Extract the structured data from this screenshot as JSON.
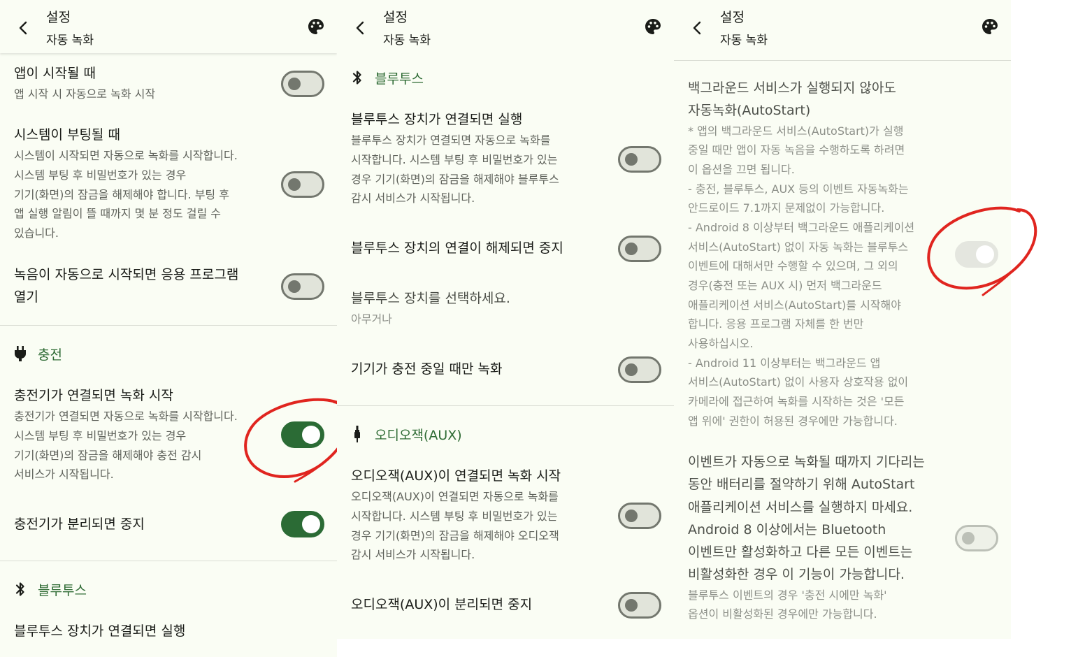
{
  "panels": [
    {
      "header": {
        "title": "설정",
        "subtitle": "자동 녹화"
      },
      "settings": [
        {
          "title": "앱이 시작될 때",
          "summary": "앱 시작 시 자동으로 녹화 시작",
          "toggle": "off"
        },
        {
          "title": "시스템이 부팅될 때",
          "summary_lines": [
            "시스템이 시작되면 자동으로 녹화를 시작합니다.",
            "시스템 부팅 후 비밀번호가 있는 경우",
            "기기(화면)의 잠금을 해제해야 합니다. 부팅 후",
            "앱 실행 알림이 뜰 때까지 몇 분 정도 걸릴 수",
            "있습니다."
          ],
          "toggle": "off"
        },
        {
          "title_lines": [
            "녹음이 자동으로 시작되면 응용 프로그램",
            "열기"
          ],
          "toggle": "off"
        },
        {
          "title": "충전기가 연결되면 녹화 시작",
          "summary_lines": [
            "충전기가 연결되면 자동으로 녹화를 시작합니다.",
            "시스템 부팅 후 비밀번호가 있는 경우",
            "기기(화면)의 잠금을 해제해야 충전 감시",
            "서비스가 시작됩니다."
          ],
          "toggle": "on"
        },
        {
          "title": "충전기가 분리되면 중지",
          "toggle": "on"
        },
        {
          "title": "블루투스 장치가 연결되면 실행"
        }
      ],
      "sections": [
        {
          "label": "충전",
          "icon": "plug-icon"
        },
        {
          "label": "블루투스",
          "icon": "bluetooth-icon"
        }
      ]
    },
    {
      "header": {
        "title": "설정",
        "subtitle": "자동 녹화"
      },
      "sections": [
        {
          "label": "블루투스",
          "icon": "bluetooth-icon"
        },
        {
          "label": "오디오잭(AUX)",
          "icon": "audio-jack-icon"
        }
      ],
      "settings": [
        {
          "title": "블루투스 장치가 연결되면 실행",
          "summary_lines": [
            "블루투스 장치가 연결되면 자동으로 녹화를",
            "시작합니다. 시스템 부팅 후 비밀번호가 있는",
            "경우 기기(화면)의 잠금을 해제해야 블루투스",
            "감시 서비스가 시작됩니다."
          ],
          "toggle": "off"
        },
        {
          "title": "블루투스 장치의 연결이 해제되면 중지",
          "toggle": "off"
        },
        {
          "title": "블루투스 장치를 선택하세요.",
          "summary": "아무거나"
        },
        {
          "title": "기기가 충전 중일 때만 녹화",
          "toggle": "off"
        },
        {
          "title": "오디오잭(AUX)이 연결되면 녹화 시작",
          "summary_lines": [
            "오디오잭(AUX)이 연결되면 자동으로 녹화를",
            "시작합니다. 시스템 부팅 후 비밀번호가 있는",
            "경우 기기(화면)의 잠금을 해제해야 오디오잭",
            "감시 서비스가 시작됩니다."
          ],
          "toggle": "off"
        },
        {
          "title": "오디오잭(AUX)이 분리되면 중지",
          "toggle": "off"
        }
      ]
    },
    {
      "header": {
        "title": "설정",
        "subtitle": "자동 녹화"
      },
      "settings": [
        {
          "title_lines": [
            "백그라운드 서비스가 실행되지 않아도",
            "자동녹화(AutoStart)"
          ],
          "summary_lines": [
            "* 앱의 백그라운드 서비스(AutoStart)가 실행",
            "중일 때만 앱이 자동 녹음을 수행하도록 하려면",
            "이 옵션을 끄면 됩니다.",
            "- 충전, 블루투스, AUX 등의 이벤트 자동녹화는",
            "안드로이드 7.1까지 문제없이 가능합니다.",
            "- Android 8 이상부터 백그라운드 애플리케이션",
            "서비스(AutoStart) 없이 자동 녹화는 블루투스",
            "이벤트에 대해서만 수행할 수 있으며, 그 외의",
            "경우(충전 또는 AUX 시) 먼저 백그라운드",
            "애플리케이션 서비스(AutoStart)를 시작해야",
            "합니다. 응용 프로그램 자체를 한 번만",
            "사용하십시오.",
            "- Android 11 이상부터는 백그라운드 앱",
            "서비스(AutoStart) 없이 사용자 상호작용 없이",
            "카메라에 접근하여 녹화를 시작하는 것은 '모든",
            "앱 위에' 권한이 허용된 경우에만 가능합니다."
          ],
          "toggle": "disabled-on"
        },
        {
          "title_lines": [
            "이벤트가 자동으로 녹화될 때까지 기다리는",
            "동안 배터리를 절약하기 위해 AutoStart",
            "애플리케이션 서비스를 실행하지 마세요.",
            "Android 8 이상에서는 Bluetooth",
            "이벤트만 활성화하고 다른 모든 이벤트는",
            "비활성화한 경우 이 기능이 가능합니다."
          ],
          "summary_lines": [
            "블루투스 이벤트의 경우 '충전 시에만 녹화'",
            "옵션이 비활성화된 경우에만 가능합니다."
          ],
          "toggle": "disabled-off"
        }
      ]
    }
  ],
  "colors": {
    "accent": "#2b6b35",
    "background": "#fafdf4",
    "annotation": "#e0251f"
  }
}
